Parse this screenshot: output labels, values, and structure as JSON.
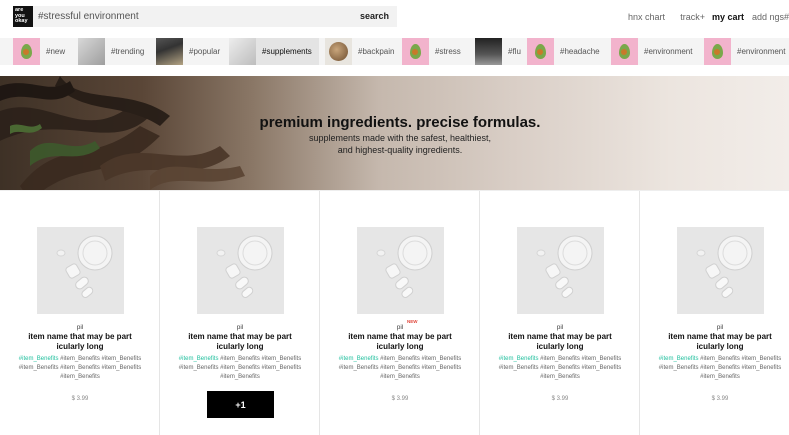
{
  "brand": {
    "logo_lines": [
      "are",
      "you",
      "okay"
    ]
  },
  "search": {
    "value": "#stressful environment",
    "button_label": "search"
  },
  "nav": [
    "hnx chart",
    "track+",
    "my cart",
    "add ngs#"
  ],
  "tags": [
    {
      "label": "#new",
      "thumb": "avocado"
    },
    {
      "label": "#trending",
      "thumb": "fog"
    },
    {
      "label": "#popular",
      "thumb": "dark"
    },
    {
      "label": "#supplements",
      "thumb": "gray",
      "active": true
    },
    {
      "label": "#backpain",
      "thumb": "round"
    },
    {
      "label": "#stress",
      "thumb": "avocado"
    },
    {
      "label": "#flu",
      "thumb": "night"
    },
    {
      "label": "#headache",
      "thumb": "avocado"
    },
    {
      "label": "#environment",
      "thumb": "avocado"
    },
    {
      "label": "#environment",
      "thumb": "avocado"
    }
  ],
  "hero": {
    "title": "premium ingredients. precise formulas.",
    "subtitle_line1": "supplements made with the safest, healthiest,",
    "subtitle_line2": "and highest-quality ingredients."
  },
  "products": [
    {
      "category": "pil",
      "name": "item name that may be part icularly long",
      "hashtags_highlight": "#item_Benefits",
      "hashtags_rest": " #item_Benefits #item_Benefits #item_Benefits #item_Benefits #item_Benefits #item_Benefits",
      "price": "$ 3.99"
    },
    {
      "category": "pil",
      "name": "item name that may be part icularly long",
      "hashtags_highlight": "#item_Benefits",
      "hashtags_rest": " #item_Benefits #item_Benefits #item_Benefits #item_Benefits #item_Benefits #item_Benefits",
      "button_label": "+1"
    },
    {
      "category": "pil",
      "badge": "NEW",
      "name": "item name that may be part icularly long",
      "hashtags_highlight": "#item_Benefits",
      "hashtags_rest": " #item_Benefits #item_Benefits #item_Benefits #item_Benefits #item_Benefits #item_Benefits",
      "price": "$ 3.99"
    },
    {
      "category": "pil",
      "name": "item name that may be part icularly long",
      "hashtags_highlight": "#item_Benefits",
      "hashtags_rest": " #item_Benefits #item_Benefits #item_Benefits #item_Benefits #item_Benefits #item_Benefits",
      "price": "$ 3.99"
    },
    {
      "category": "pil",
      "name": "item name that may be part icularly long",
      "hashtags_highlight": "#item_Benefits",
      "hashtags_rest": " #item_Benefits #item_Benefits #item_Benefits #item_Benefits #item_Benefits #item_Benefits",
      "price": "$ 3.99"
    }
  ],
  "colors": {
    "accent": "#1fbf9d",
    "new_badge": "#e0473c",
    "button": "#000000",
    "tag_thumb_pink": "#f2b3cc"
  }
}
